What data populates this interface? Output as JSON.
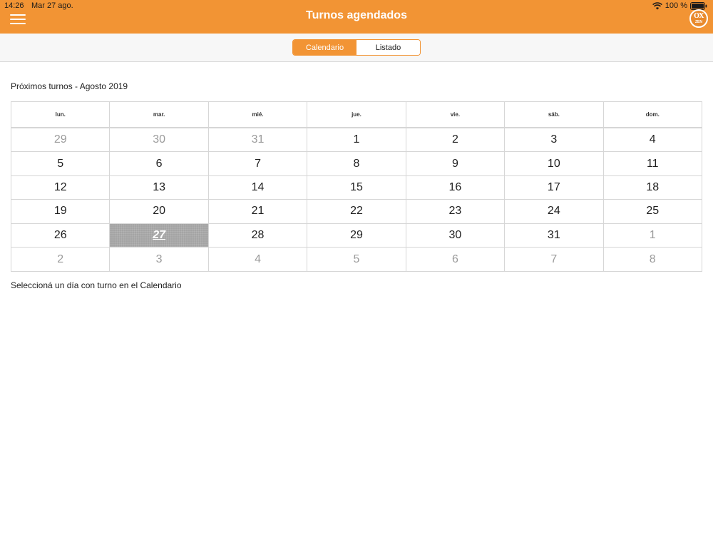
{
  "status_bar": {
    "time": "14:26",
    "date": "Mar 27 ago.",
    "battery": "100 %"
  },
  "nav": {
    "title": "Turnos agendados",
    "logo_top": "OX",
    "logo_bottom": "ZEN",
    "accent_color": "#f29434"
  },
  "tabs": [
    {
      "label": "Calendario",
      "active": true
    },
    {
      "label": "Listado",
      "active": false
    }
  ],
  "section_title": "Próximos turnos - Agosto 2019",
  "calendar": {
    "weekdays": [
      "lun.",
      "mar.",
      "mié.",
      "jue.",
      "vie.",
      "sáb.",
      "dom."
    ],
    "weeks": [
      [
        {
          "day": "29",
          "current_month": false
        },
        {
          "day": "30",
          "current_month": false
        },
        {
          "day": "31",
          "current_month": false
        },
        {
          "day": "1",
          "current_month": true
        },
        {
          "day": "2",
          "current_month": true
        },
        {
          "day": "3",
          "current_month": true
        },
        {
          "day": "4",
          "current_month": true
        }
      ],
      [
        {
          "day": "5",
          "current_month": true
        },
        {
          "day": "6",
          "current_month": true
        },
        {
          "day": "7",
          "current_month": true
        },
        {
          "day": "8",
          "current_month": true
        },
        {
          "day": "9",
          "current_month": true
        },
        {
          "day": "10",
          "current_month": true
        },
        {
          "day": "11",
          "current_month": true
        }
      ],
      [
        {
          "day": "12",
          "current_month": true
        },
        {
          "day": "13",
          "current_month": true
        },
        {
          "day": "14",
          "current_month": true
        },
        {
          "day": "15",
          "current_month": true
        },
        {
          "day": "16",
          "current_month": true
        },
        {
          "day": "17",
          "current_month": true
        },
        {
          "day": "18",
          "current_month": true
        }
      ],
      [
        {
          "day": "19",
          "current_month": true
        },
        {
          "day": "20",
          "current_month": true
        },
        {
          "day": "21",
          "current_month": true
        },
        {
          "day": "22",
          "current_month": true
        },
        {
          "day": "23",
          "current_month": true
        },
        {
          "day": "24",
          "current_month": true
        },
        {
          "day": "25",
          "current_month": true
        }
      ],
      [
        {
          "day": "26",
          "current_month": true
        },
        {
          "day": "27",
          "current_month": true,
          "today": true
        },
        {
          "day": "28",
          "current_month": true
        },
        {
          "day": "29",
          "current_month": true
        },
        {
          "day": "30",
          "current_month": true
        },
        {
          "day": "31",
          "current_month": true
        },
        {
          "day": "1",
          "current_month": false
        }
      ],
      [
        {
          "day": "2",
          "current_month": false
        },
        {
          "day": "3",
          "current_month": false
        },
        {
          "day": "4",
          "current_month": false
        },
        {
          "day": "5",
          "current_month": false
        },
        {
          "day": "6",
          "current_month": false
        },
        {
          "day": "7",
          "current_month": false
        },
        {
          "day": "8",
          "current_month": false
        }
      ]
    ]
  },
  "hint": "Seleccioná un día con turno en el Calendario"
}
